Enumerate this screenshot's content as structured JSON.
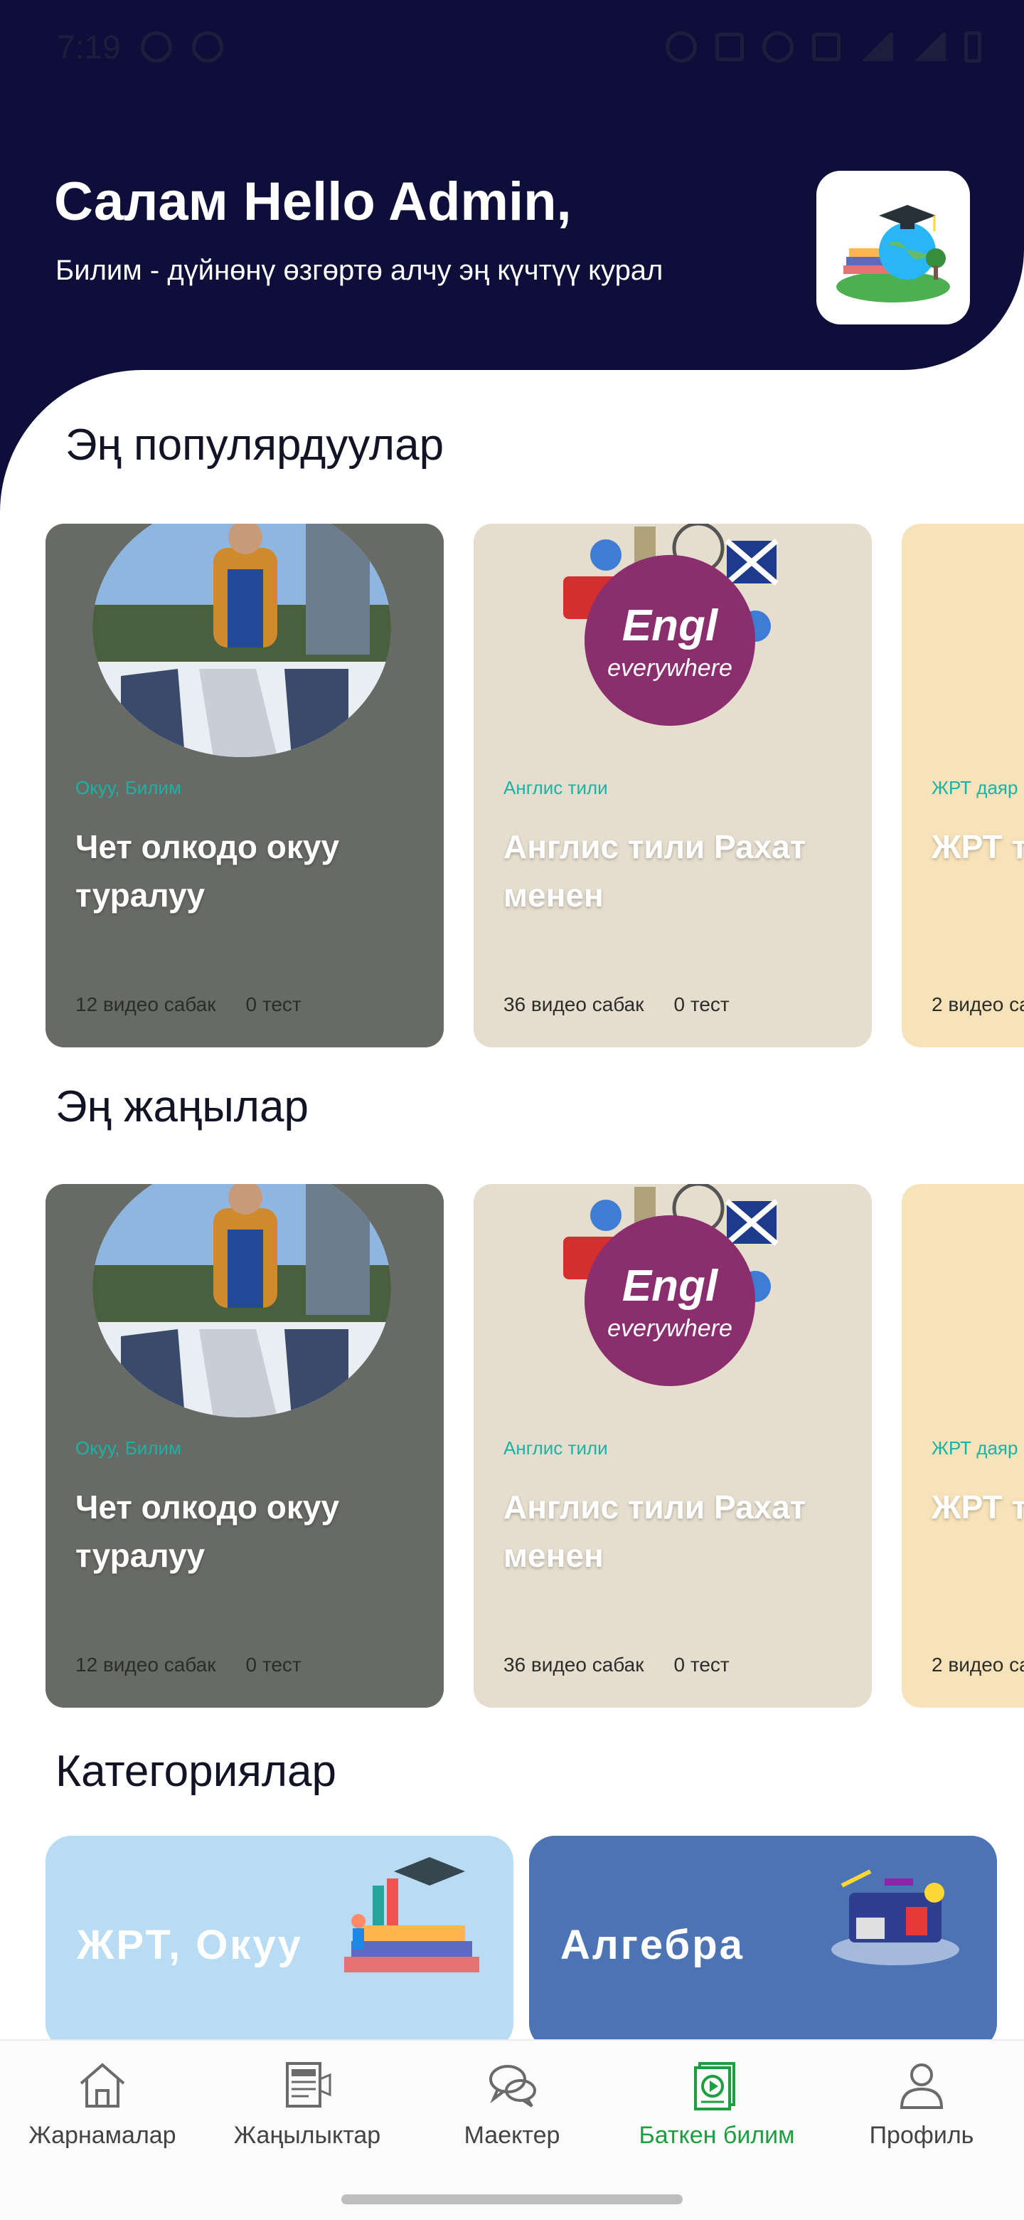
{
  "status_bar": {
    "time": "7:19"
  },
  "header": {
    "greeting": "Салам Hello Admin,",
    "subtitle": "Билим - дүйнөнү өзгөртө алчу эң күчтүү курал",
    "logo_icon": "graduation-globe-logo"
  },
  "sections": {
    "popular": "Эң популярдуулар",
    "newest": "Эң жаңылар",
    "categories": "Категориялар"
  },
  "courses": [
    {
      "tag": "Окуу, Билим",
      "title": "Чет олкодо окуу туралуу",
      "videos": "12 видео сабак",
      "tests": "0 тест",
      "bg": "#686a65"
    },
    {
      "tag": "Англис тили",
      "title": "Англис тили Рахат менен",
      "videos": "36 видео сабак",
      "tests": "0 тест",
      "bg": "#e5ddcd"
    },
    {
      "tag": "ЖРТ даяр",
      "title": "ЖРТ т",
      "videos": "2 видео са",
      "tests": "",
      "bg": "#f7e2b9"
    }
  ],
  "categories": [
    {
      "label": "ЖРТ, Окуу",
      "bg": "#b8dcf3"
    },
    {
      "label": "Алгебра",
      "bg": "#4c74b5"
    }
  ],
  "nav": [
    {
      "label": "Жарнамалар",
      "icon": "home-icon"
    },
    {
      "label": "Жаңылыктар",
      "icon": "newspaper-icon"
    },
    {
      "label": "Маектер",
      "icon": "chat-icon"
    },
    {
      "label": "Баткен билим",
      "icon": "video-lessons-icon",
      "active": true
    },
    {
      "label": "Профиль",
      "icon": "profile-icon"
    }
  ]
}
